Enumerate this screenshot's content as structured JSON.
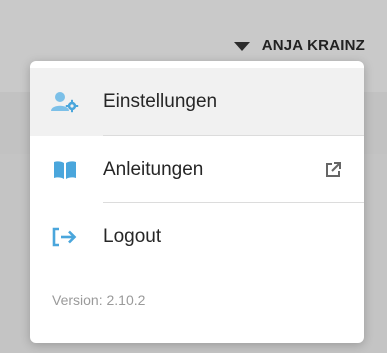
{
  "header": {
    "user_name": "ANJA KRAINZ",
    "caret_icon": "caret-down-icon"
  },
  "menu": {
    "items": [
      {
        "label": "Einstellungen",
        "icon": "user-settings-icon",
        "highlighted": true
      },
      {
        "label": "Anleitungen",
        "icon": "book-icon",
        "trailing_icon": "external-link-icon"
      },
      {
        "label": "Logout",
        "icon": "logout-icon"
      }
    ],
    "version": "Version: 2.10.2"
  },
  "colors": {
    "accent": "#4aa6dc",
    "page_background": "#c4c4c4",
    "menu_background": "#ffffff",
    "highlight_background": "#f1f1f1",
    "text": "#262626",
    "muted_text": "#9a9a9a"
  }
}
